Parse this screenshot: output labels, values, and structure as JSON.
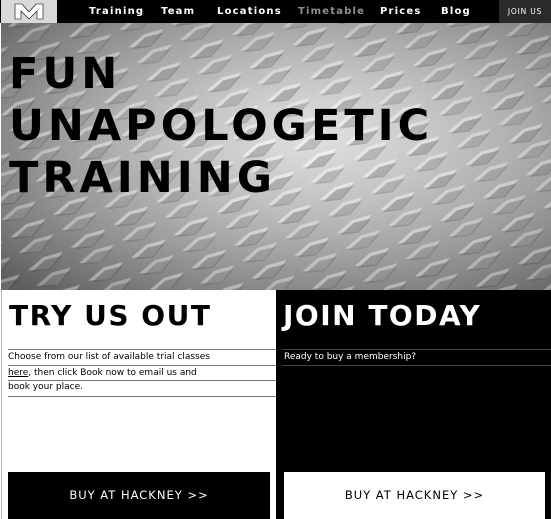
{
  "nav": {
    "logo_label": "M",
    "items": [
      {
        "label": "Training"
      },
      {
        "label": "Team"
      },
      {
        "label": "Locations"
      },
      {
        "label": "Timetable"
      },
      {
        "label": "Prices"
      },
      {
        "label": "Blog"
      }
    ],
    "join_label": "JOIN US"
  },
  "hero": {
    "lines": [
      "FUN",
      "UNAPOLOGETIC",
      "TRAINING"
    ]
  },
  "try": {
    "title": "TRY US OUT",
    "line1": "Choose from our list of available trial classes",
    "link": "here",
    "line2_rest": ", then click Book now to email us and",
    "line3": "book your place.",
    "button": "BUY AT HACKNEY >>"
  },
  "join": {
    "title": "JOIN TODAY",
    "line1": "Ready to buy a membership?",
    "button": "BUY AT HACKNEY >>"
  },
  "colors": {
    "nav_bg": "#000000",
    "logo_bg": "#d9d9d9",
    "panel_dark": "#000000",
    "panel_light": "#ffffff"
  }
}
